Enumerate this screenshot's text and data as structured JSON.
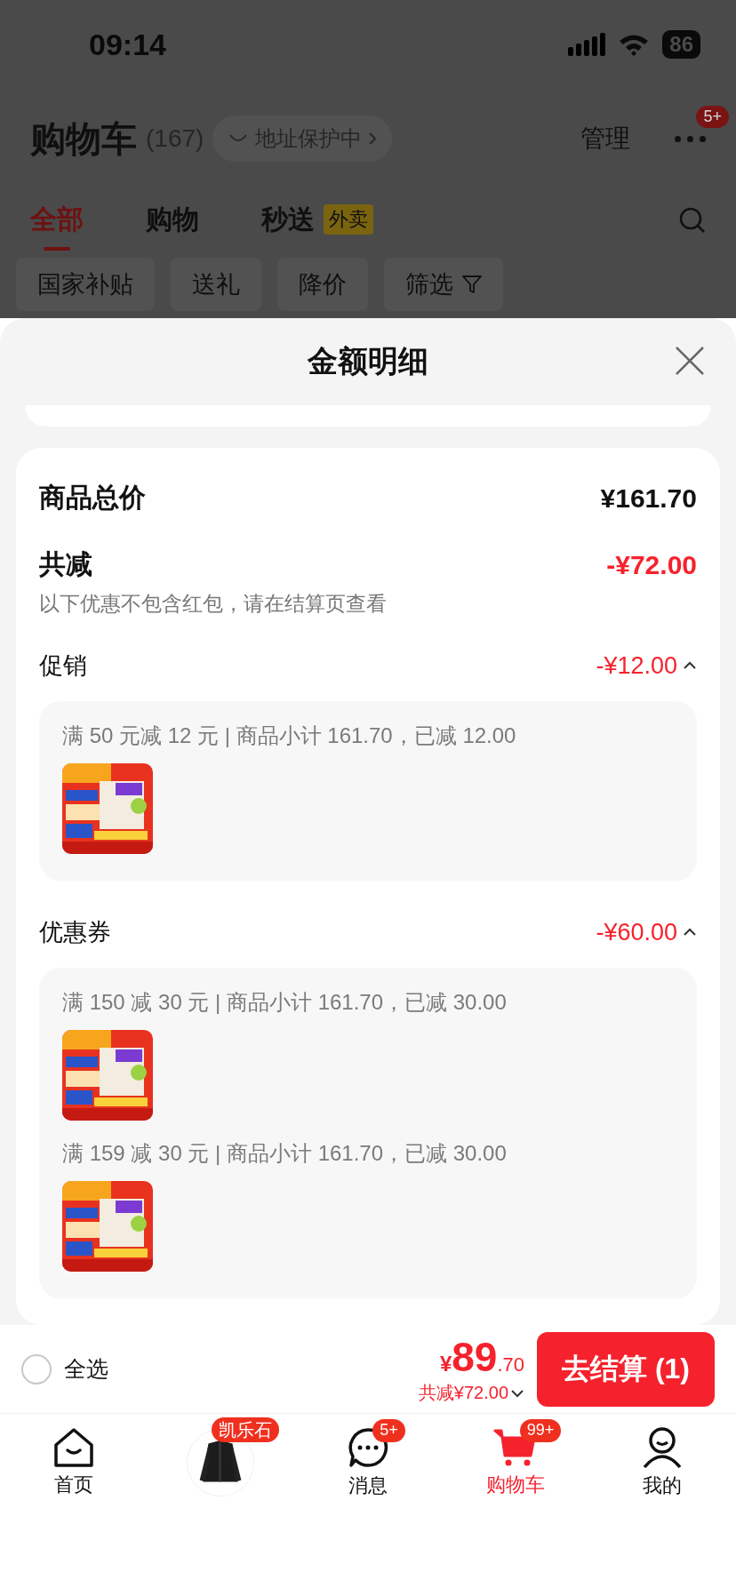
{
  "status_bar": {
    "time": "09:14",
    "battery": "86"
  },
  "header": {
    "title": "购物车",
    "count": "(167)",
    "address_chip": "地址保护中",
    "manage": "管理",
    "more_badge": "5+"
  },
  "tabs": [
    {
      "label": "全部",
      "selected": true
    },
    {
      "label": "购物",
      "selected": false
    },
    {
      "label": "秒送",
      "tag": "外卖",
      "selected": false
    }
  ],
  "filters": [
    {
      "label": "国家补贴",
      "kind": "plain"
    },
    {
      "label": "送礼",
      "kind": "plain"
    },
    {
      "label": "降价",
      "kind": "plain"
    },
    {
      "label": "筛选",
      "kind": "filter"
    }
  ],
  "sheet": {
    "title": "金额明细",
    "total_label": "商品总价",
    "total": "¥161.70",
    "discount_label": "共减",
    "discount": "-¥72.00",
    "note": "以下优惠不包含红包，请在结算页查看",
    "groups": [
      {
        "label": "促销",
        "amount": "-¥12.00",
        "expanded": true,
        "items": [
          {
            "text": "满 50 元减 12 元 | 商品小计 161.70，已减 12.00"
          }
        ]
      },
      {
        "label": "优惠券",
        "amount": "-¥60.00",
        "expanded": true,
        "items": [
          {
            "text": "满 150 减 30 元 | 商品小计 161.70，已减 30.00"
          },
          {
            "text": "满 159 减 30 元 | 商品小计 161.70，已减 30.00"
          }
        ]
      }
    ]
  },
  "checkout": {
    "select_all": "全选",
    "checked": false,
    "currency": "¥",
    "price_int": "89",
    "price_dec": ".70",
    "discount": "共减¥72.00",
    "button": "去结算 (1)"
  },
  "nav": [
    {
      "kind": "home",
      "label": "首页",
      "selected": false
    },
    {
      "kind": "avatar",
      "badge": "凯乐石",
      "selected": false
    },
    {
      "kind": "chat",
      "label": "消息",
      "badge": "5+",
      "selected": false
    },
    {
      "kind": "cart",
      "label": "购物车",
      "badge": "99+",
      "selected": true
    },
    {
      "kind": "user",
      "label": "我的",
      "selected": false
    }
  ]
}
